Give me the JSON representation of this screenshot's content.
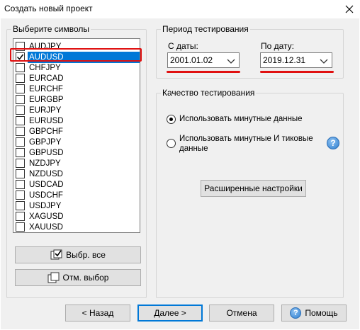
{
  "window": {
    "title": "Создать новый проект",
    "close_icon": "close-icon"
  },
  "symbols_group": {
    "title": "Выберите символы",
    "items": [
      {
        "label": "AUDJPY",
        "checked": false,
        "selected": false
      },
      {
        "label": "AUDUSD",
        "checked": true,
        "selected": true
      },
      {
        "label": "CHFJPY",
        "checked": false,
        "selected": false
      },
      {
        "label": "EURCAD",
        "checked": false,
        "selected": false
      },
      {
        "label": "EURCHF",
        "checked": false,
        "selected": false
      },
      {
        "label": "EURGBP",
        "checked": false,
        "selected": false
      },
      {
        "label": "EURJPY",
        "checked": false,
        "selected": false
      },
      {
        "label": "EURUSD",
        "checked": false,
        "selected": false
      },
      {
        "label": "GBPCHF",
        "checked": false,
        "selected": false
      },
      {
        "label": "GBPJPY",
        "checked": false,
        "selected": false
      },
      {
        "label": "GBPUSD",
        "checked": false,
        "selected": false
      },
      {
        "label": "NZDJPY",
        "checked": false,
        "selected": false
      },
      {
        "label": "NZDUSD",
        "checked": false,
        "selected": false
      },
      {
        "label": "USDCAD",
        "checked": false,
        "selected": false
      },
      {
        "label": "USDCHF",
        "checked": false,
        "selected": false
      },
      {
        "label": "USDJPY",
        "checked": false,
        "selected": false
      },
      {
        "label": "XAGUSD",
        "checked": false,
        "selected": false
      },
      {
        "label": "XAUUSD",
        "checked": false,
        "selected": false
      }
    ],
    "select_all_label": "Выбр. все",
    "deselect_label": "Отм. выбор"
  },
  "period_group": {
    "title": "Период тестирования",
    "from_label": "С даты:",
    "from_value": "2001.01.02",
    "to_label": "По дату:",
    "to_value": "2019.12.31"
  },
  "quality_group": {
    "title": "Качество тестирования",
    "option1": "Использовать минутные данные",
    "option1_selected": true,
    "option2_line1": "Использовать минутные И тиковые",
    "option2_line2": "данные",
    "option2_selected": false,
    "help_glyph": "?",
    "advanced_label": "Расширенные настройки"
  },
  "footer": {
    "back_label": "< Назад",
    "next_label": "Далее >",
    "cancel_label": "Отмена",
    "help_label": "Помощь",
    "help_glyph": "?"
  },
  "colors": {
    "selection": "#0078d7",
    "highlight": "#e01010",
    "help_icon": "#2f7fd0"
  }
}
